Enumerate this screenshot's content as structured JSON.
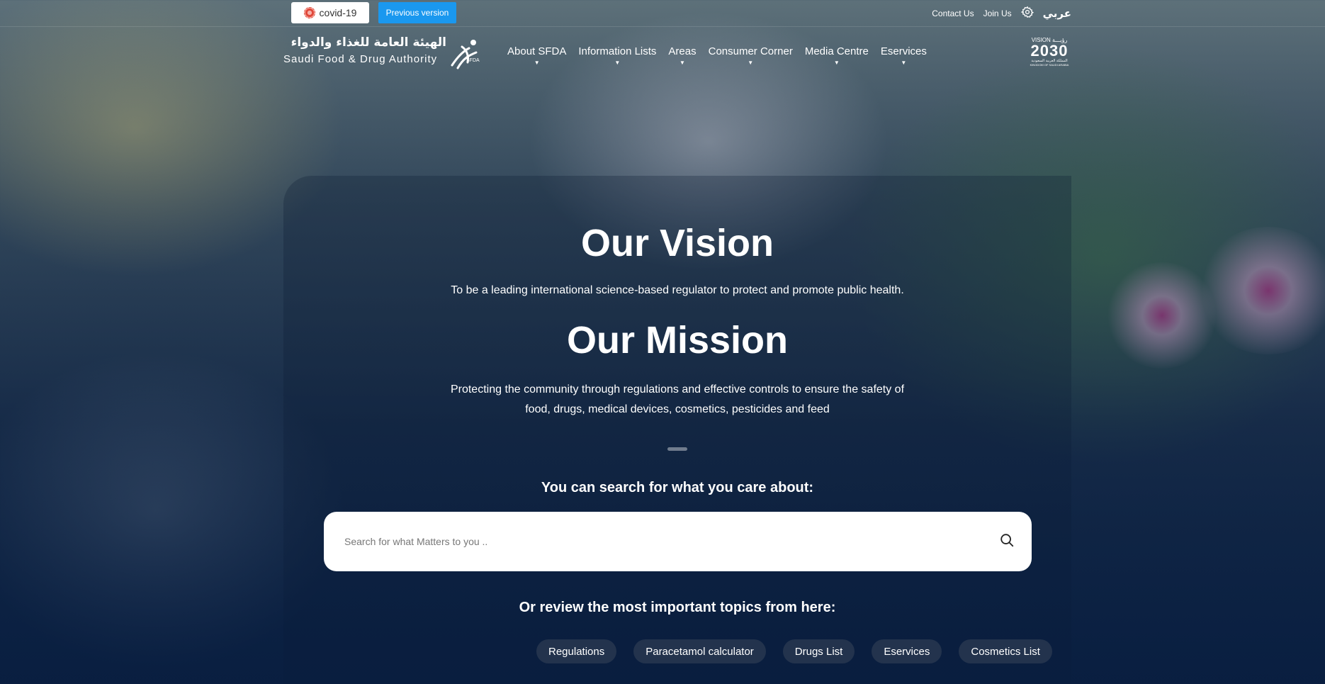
{
  "topbar": {
    "covid_label": "covid-19",
    "previous_version_label": "Previous version",
    "contact_us": "Contact Us",
    "join_us": "Join Us",
    "settings_icon": "gear-icon",
    "language_label": "عربي"
  },
  "logo": {
    "arabic_name": "الهيئة العامة للغذاء والدواء",
    "english_name": "Saudi Food & Drug Authority",
    "mark_text": "SFDA"
  },
  "nav": {
    "items": [
      "About SFDA",
      "Information Lists",
      "Areas",
      "Consumer Corner",
      "Media Centre",
      "Eservices"
    ]
  },
  "vision_logo": {
    "top": "VISION رؤيـــة",
    "year": "2030",
    "sub": "المملكة العربية السعودية",
    "sub_en": "KINGDOM OF SAUDI ARABIA"
  },
  "hero": {
    "vision_title": "Our Vision",
    "vision_text": "To be a leading international science-based regulator to protect and promote public health.",
    "mission_title": "Our Mission",
    "mission_text": "Protecting the community through regulations and effective controls to ensure the safety of food, drugs, medical devices, cosmetics, pesticides and feed"
  },
  "search": {
    "heading": "You can search for what you care about:",
    "placeholder": "Search for what Matters to you ..",
    "icon": "search-icon"
  },
  "topics": {
    "heading": "Or review the most important topics from here:",
    "chips": [
      "Regulations",
      "Paracetamol calculator",
      "Drugs List",
      "Eservices",
      "Cosmetics List"
    ]
  },
  "colors": {
    "primary_blue": "#1a98ef",
    "chip_bg": "#283750",
    "deep_navy": "#0d2648"
  }
}
